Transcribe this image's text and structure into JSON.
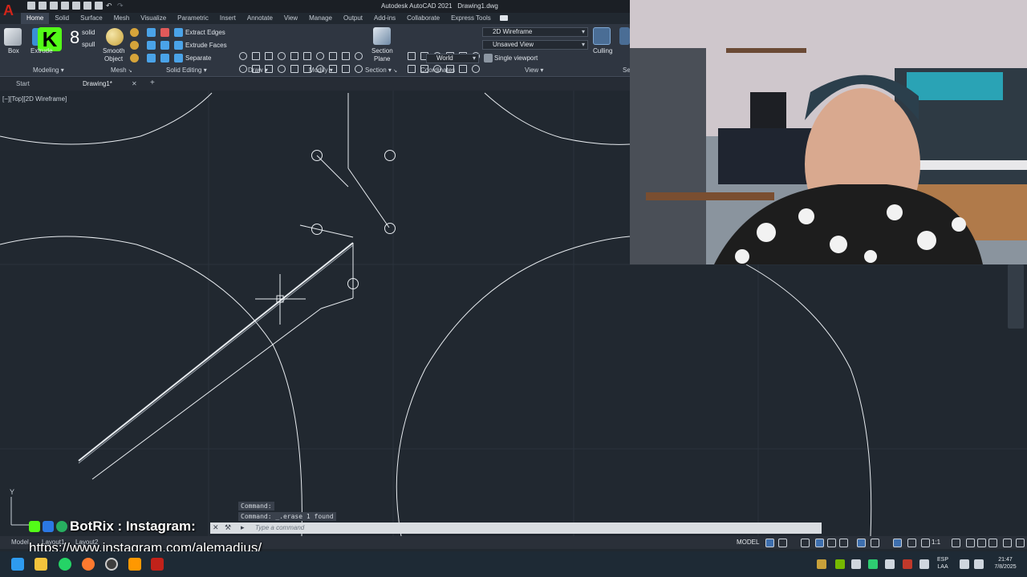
{
  "window": {
    "app_title": "Autodesk AutoCAD 2021",
    "file_name": "Drawing1.dwg"
  },
  "ribbon_tabs": [
    "Home",
    "Solid",
    "Surface",
    "Mesh",
    "Visualize",
    "Parametric",
    "Insert",
    "Annotate",
    "View",
    "Manage",
    "Output",
    "Add-ins",
    "Collaborate",
    "Express Tools"
  ],
  "ribbon": {
    "box": "Box",
    "extrude": "Extrude",
    "smooth_object": "Smooth\nObject",
    "smooth_object_l1": "Smooth",
    "smooth_object_l2": "Object",
    "extract_edges": "Extract Edges",
    "extrude_faces": "Extrude Faces",
    "separate": "Separate",
    "section_plane_l1": "Section",
    "section_plane_l2": "Plane",
    "visual_style": "2D Wireframe",
    "named_view": "Unsaved View",
    "ucs": "World",
    "viewport": "Single viewport",
    "culling": "Culling",
    "panels": {
      "modeling": "Modeling",
      "mesh": "Mesh",
      "solid_editing": "Solid Editing",
      "draw": "Draw",
      "modify": "Modify",
      "section": "Section",
      "coordinates": "Coordinates",
      "view": "View"
    }
  },
  "file_tabs": {
    "start": "Start",
    "drawing": "Drawing1*"
  },
  "viewport_label": "[−][Top][2D Wireframe]",
  "command": {
    "history_1": "Command:",
    "history_2": "Command: _.erase 1 found",
    "placeholder": "Type a command"
  },
  "overlay": {
    "botrix": "BotRix : Instagram:",
    "url": "https://www.instagram.com/alemadius/"
  },
  "layout_tabs": [
    "Model",
    "Layout1",
    "Layout2"
  ],
  "status": {
    "model": "MODEL",
    "scale": "1:1"
  },
  "tray": {
    "lang_1": "ESP",
    "lang_2": "LAA",
    "time": "21:47",
    "date": "7/8/2025"
  },
  "colors": {
    "canvas": "#212830",
    "ribbon": "#2f3641",
    "autocad_red": "#d1251a",
    "geometry": "#e8ecf0"
  }
}
